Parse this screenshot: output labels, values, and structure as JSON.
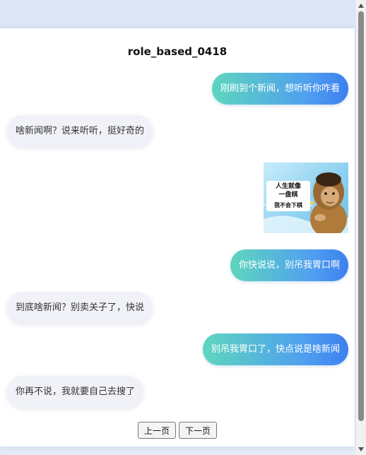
{
  "chat": {
    "title": "role_based_0418",
    "messages": [
      {
        "role": "sent",
        "text": "刚刷到个新闻，想听听你咋看"
      },
      {
        "role": "recv",
        "text": "啥新闻啊？说来听听，挺好奇的"
      },
      {
        "role": "sent",
        "type": "image",
        "image_text": [
          "人生就像",
          "一盘棋",
          "我不会下棋"
        ]
      },
      {
        "role": "sent",
        "text": "你快说说，别吊我胃口啊"
      },
      {
        "role": "recv",
        "text": "到底啥新闻？别卖关子了，快说"
      },
      {
        "role": "sent",
        "text": "别吊我胃口了，快点说是啥新闻"
      },
      {
        "role": "recv",
        "text": "你再不说，我就要自己去搜了"
      }
    ]
  },
  "pager": {
    "prev_label": "上一页",
    "next_label": "下一页"
  },
  "colors": {
    "sent_gradient_start": "#5fd6be",
    "sent_gradient_end": "#3d80ee",
    "recv_bubble": "#f0f2f7",
    "page_background": "#dde6f7"
  }
}
